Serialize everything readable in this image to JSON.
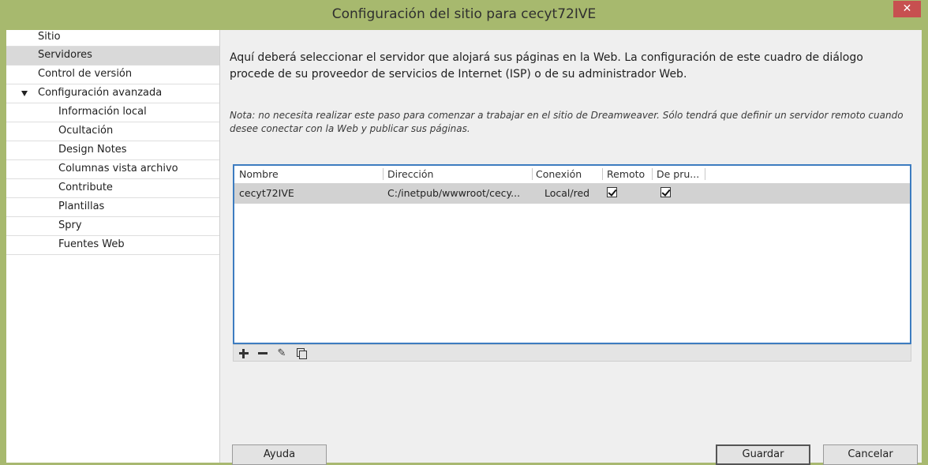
{
  "window": {
    "title": "Configuración del sitio para cecyt72IVE",
    "close_glyph": "✕"
  },
  "sidebar": {
    "items": [
      {
        "label": "Sitio",
        "level": 0
      },
      {
        "label": "Servidores",
        "level": 0,
        "selected": true
      },
      {
        "label": "Control de versión",
        "level": 0
      },
      {
        "label": "Configuración avanzada",
        "level": 0,
        "expanded": true
      },
      {
        "label": "Información local",
        "level": 1
      },
      {
        "label": "Ocultación",
        "level": 1
      },
      {
        "label": "Design Notes",
        "level": 1
      },
      {
        "label": "Columnas vista archivo",
        "level": 1
      },
      {
        "label": "Contribute",
        "level": 1
      },
      {
        "label": "Plantillas",
        "level": 1
      },
      {
        "label": "Spry",
        "level": 1
      },
      {
        "label": "Fuentes Web",
        "level": 1
      }
    ]
  },
  "main": {
    "intro": "Aquí deberá seleccionar el servidor que alojará sus páginas en la Web. La configuración de este cuadro de diálogo procede de su proveedor de servicios de Internet (ISP) o de su administrador Web.",
    "note": "Nota: no necesita realizar este paso para comenzar a trabajar en el sitio de Dreamweaver. Sólo tendrá que definir un servidor remoto cuando desee conectar con la Web y publicar sus páginas."
  },
  "table": {
    "headers": [
      "Nombre",
      "Dirección",
      "Conexión",
      "Remoto",
      "De pru..."
    ],
    "rows": [
      {
        "nombre": "cecyt72IVE",
        "direccion": "C:/inetpub/wwwroot/cecy...",
        "conexion": "Local/red",
        "remoto": true,
        "de_prueba": true
      }
    ]
  },
  "toolbar": {
    "icons": [
      "plus-icon",
      "minus-icon",
      "pencil-icon",
      "duplicate-icon"
    ],
    "pencil_glyph": "✎"
  },
  "buttons": {
    "help": "Ayuda",
    "save": "Guardar",
    "cancel": "Cancelar"
  },
  "colors": {
    "chrome": "#a7b96e",
    "close": "#c75050",
    "table_border": "#3d7cc0",
    "selected_row": "#d2d2d2"
  }
}
